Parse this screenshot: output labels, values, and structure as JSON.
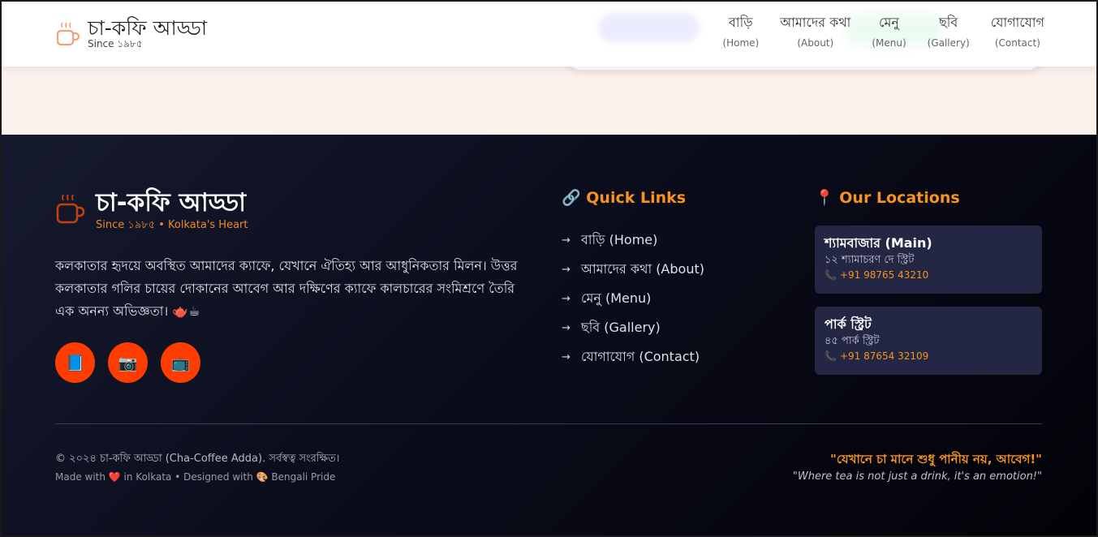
{
  "header": {
    "brand_title": "চা-কফি আড্ডা",
    "brand_sub": "Since ১৯৮৫",
    "nav": [
      {
        "bn": "বাড়ি",
        "en": "(Home)"
      },
      {
        "bn": "আমাদের কথা",
        "en": "(About)"
      },
      {
        "bn": "মেনু",
        "en": "(Menu)"
      },
      {
        "bn": "ছবি",
        "en": "(Gallery)"
      },
      {
        "bn": "যোগাযোগ",
        "en": "(Contact)"
      }
    ]
  },
  "footer": {
    "brand_title": "চা-কফি আড্ডা",
    "brand_sub": "Since ১৯৮৫ • Kolkata's Heart",
    "description": "কলকাতার হৃদয়ে অবস্থিত আমাদের ক্যাফে, যেখানে ঐতিহ্য আর আধুনিকতার মিলন। উত্তর কলকাতার গলির চায়ের দোকানের আবেগ আর দক্ষিণের ক্যাফে কালচারের সংমিশ্রণে তৈরি এক অনন্য অভিজ্ঞতা। 🫖☕",
    "socials": [
      {
        "icon": "book-icon",
        "glyph": "📘"
      },
      {
        "icon": "camera-icon",
        "glyph": "📷"
      },
      {
        "icon": "tv-icon",
        "glyph": "📺"
      }
    ],
    "quick_links": {
      "heading": "🔗 Quick Links",
      "arrow": "→",
      "items": [
        "বাড়ি (Home)",
        "আমাদের কথা (About)",
        "মেনু (Menu)",
        "ছবি (Gallery)",
        "যোগাযোগ (Contact)"
      ]
    },
    "locations": {
      "heading": "📍 Our Locations",
      "phone_glyph": "📞",
      "items": [
        {
          "name": "শ্যামবাজার (Main)",
          "address": "১২ শ্যামাচরণ দে স্ট্রিট",
          "phone": "+91 98765 43210"
        },
        {
          "name": "পার্ক স্ট্রিট",
          "address": "৪৫ পার্ক স্ট্রিট",
          "phone": "+91 87654 32109"
        }
      ]
    },
    "copyright": "© ২০২৪ চা-কফি আড্ডা (Cha-Coffee Adda). সর্বস্বত্ব সংরক্ষিত।",
    "made_with": "Made with ❤️ in Kolkata • Designed with 🎨 Bengali Pride",
    "quote_bn": "\"যেখানে চা মানে শুধু পানীয় নয়, আবেগ!\"",
    "quote_en": "\"Where tea is not just a drink, it's an emotion!\""
  },
  "colors": {
    "accent": "#f7931e",
    "social_bg": "#ff3d00",
    "card_bg": "#232743"
  }
}
